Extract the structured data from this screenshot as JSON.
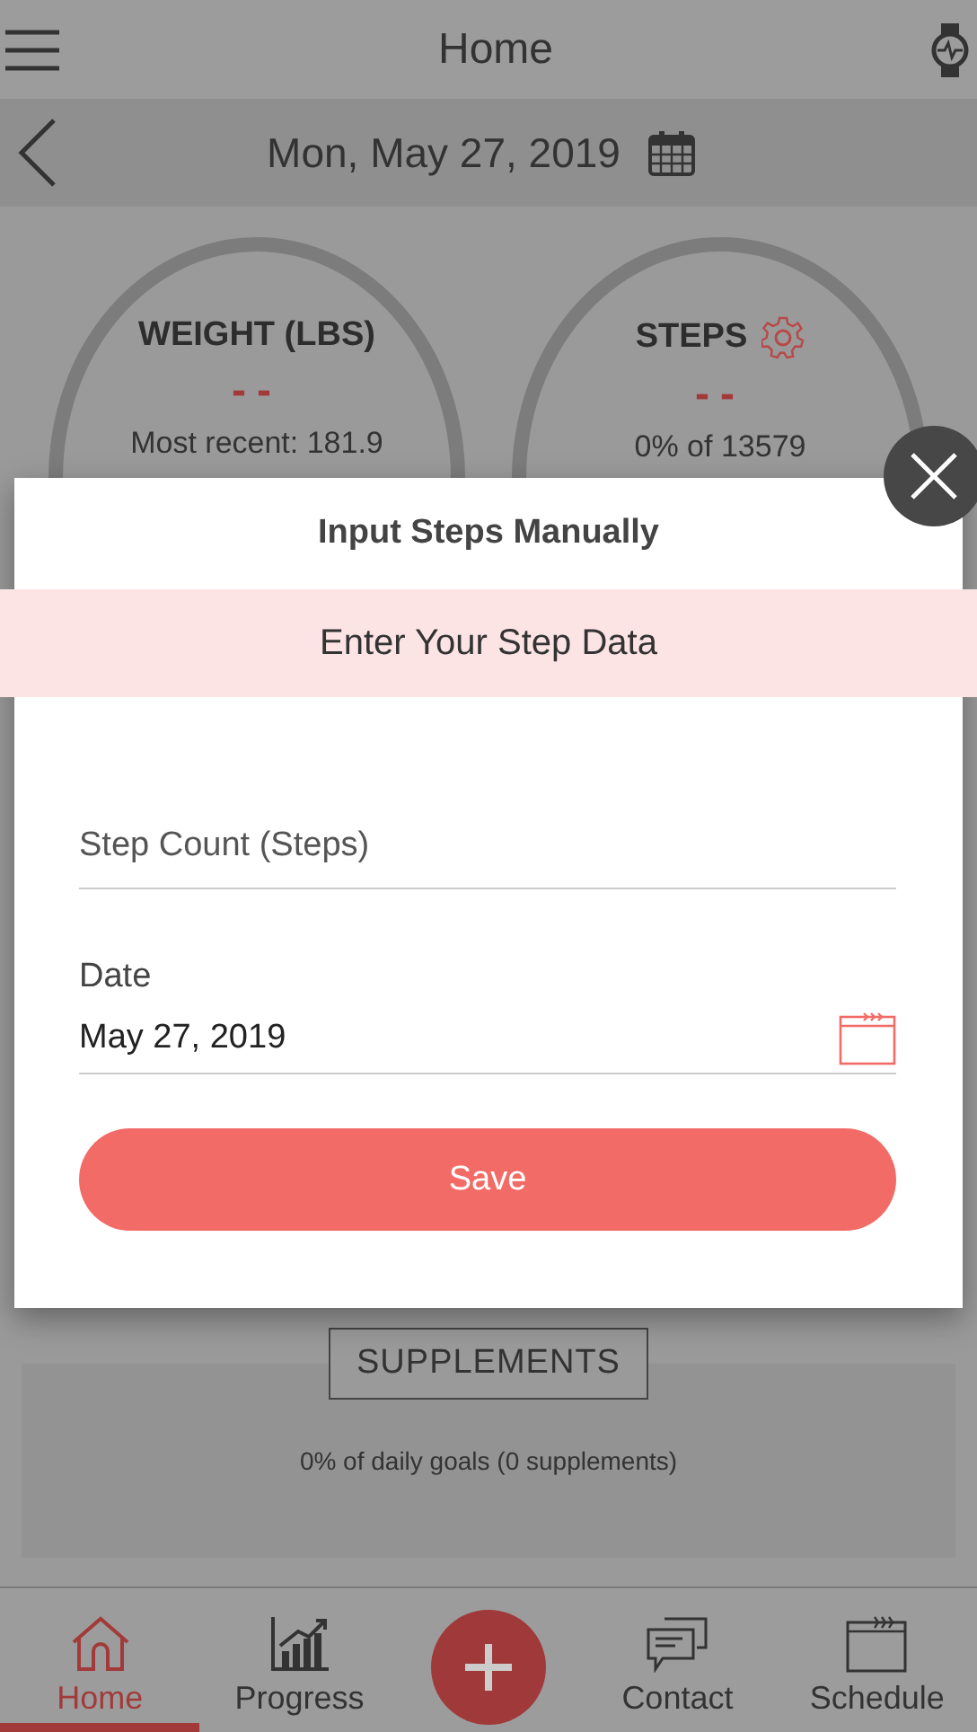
{
  "header": {
    "title": "Home"
  },
  "date_bar": {
    "date": "Mon, May 27, 2019"
  },
  "cards": [
    {
      "kind": "plain",
      "title": "WEIGHT (LBS)",
      "value": "--",
      "subtitle": "Most recent: 181.9"
    },
    {
      "kind": "settings",
      "title": "STEPS",
      "value": "--",
      "subtitle": "0% of 13579"
    }
  ],
  "dialog": {
    "title": "Input Steps Manually",
    "banner": "Enter Your Step Data",
    "step_field": {
      "placeholder": "Step Count (Steps)"
    },
    "date_field": {
      "label": "Date",
      "value": "May 27, 2019"
    },
    "save_button": "Save"
  },
  "supplements": {
    "title": "SUPPLEMENTS",
    "summary": "0% of daily goals (0 supplements)"
  },
  "nav": [
    {
      "kind": "home",
      "label": "Home",
      "selected": true
    },
    {
      "kind": "progress",
      "label": "Progress",
      "selected": false
    },
    {
      "kind": "add",
      "selected": false
    },
    {
      "kind": "contact",
      "label": "Contact",
      "selected": false
    },
    {
      "kind": "schedule",
      "label": "Schedule",
      "selected": false
    }
  ]
}
